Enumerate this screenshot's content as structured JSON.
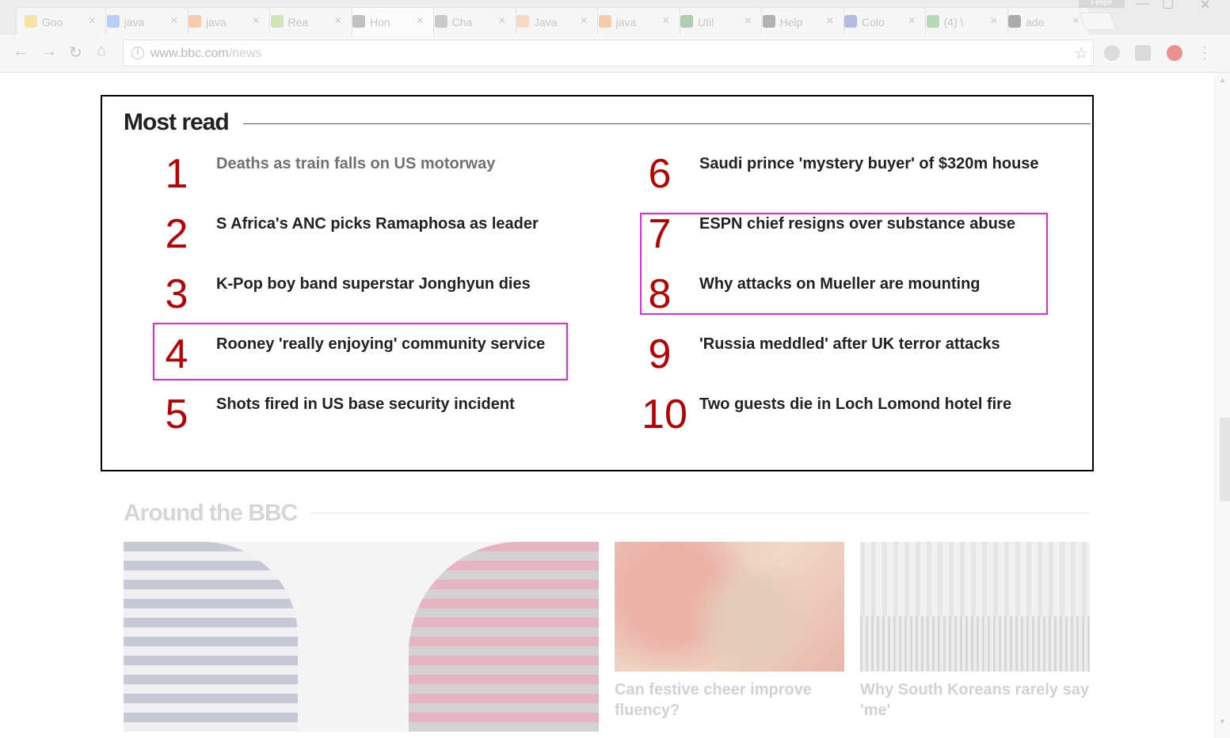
{
  "browser": {
    "profile_name": "Felipe",
    "tabs": [
      {
        "title": "Goo",
        "favicon_color": "#f4c20d"
      },
      {
        "title": "java",
        "favicon_color": "#4285f4"
      },
      {
        "title": "java",
        "favicon_color": "#f48024"
      },
      {
        "title": "Rea",
        "favicon_color": "#8bc34a"
      },
      {
        "title": "Hon",
        "favicon_color": "#555555"
      },
      {
        "title": "Cha",
        "favicon_color": "#777777"
      },
      {
        "title": "Java",
        "favicon_color": "#f4a261"
      },
      {
        "title": "java",
        "favicon_color": "#f48024"
      },
      {
        "title": "Util",
        "favicon_color": "#2e7d32"
      },
      {
        "title": "Help",
        "favicon_color": "#333333"
      },
      {
        "title": "Colo",
        "favicon_color": "#3f51b5"
      },
      {
        "title": "(4) \\",
        "favicon_color": "#43a047"
      },
      {
        "title": "ade",
        "favicon_color": "#222222"
      }
    ],
    "active_tab_index": 4,
    "close_glyph": "×",
    "url_host": "www.bbc.com",
    "url_path": "/news",
    "extension_colors": [
      "#c8c8c8",
      "#c8c8c8",
      "#e44a4a"
    ]
  },
  "most_read": {
    "title": "Most read",
    "items": [
      {
        "rank": "1",
        "headline": "Deaths as train falls on US motorway",
        "visited": true
      },
      {
        "rank": "2",
        "headline": "S Africa's ANC picks Ramaphosa as leader",
        "visited": false
      },
      {
        "rank": "3",
        "headline": "K-Pop boy band superstar Jonghyun dies",
        "visited": false
      },
      {
        "rank": "4",
        "headline": "Rooney 'really enjoying' community service",
        "visited": false
      },
      {
        "rank": "5",
        "headline": "Shots fired in US base security incident",
        "visited": false
      },
      {
        "rank": "6",
        "headline": "Saudi prince 'mystery buyer' of $320m house",
        "visited": false
      },
      {
        "rank": "7",
        "headline": "ESPN chief resigns over substance abuse",
        "visited": false
      },
      {
        "rank": "8",
        "headline": "Why attacks on Mueller are mounting",
        "visited": false
      },
      {
        "rank": "9",
        "headline": "'Russia meddled' after UK terror attacks",
        "visited": false
      },
      {
        "rank": "10",
        "headline": "Two guests die in Loch Lomond hotel fire",
        "visited": false
      }
    ],
    "highlight_color": "#e22be0"
  },
  "around_bbc": {
    "title": "Around the BBC",
    "cards": [
      {
        "caption": ""
      },
      {
        "caption_line1": "Can festive cheer improve",
        "caption_line2": "fluency?"
      },
      {
        "caption_line1": "Why South Koreans rarely say",
        "caption_line2": "'me'"
      }
    ]
  }
}
